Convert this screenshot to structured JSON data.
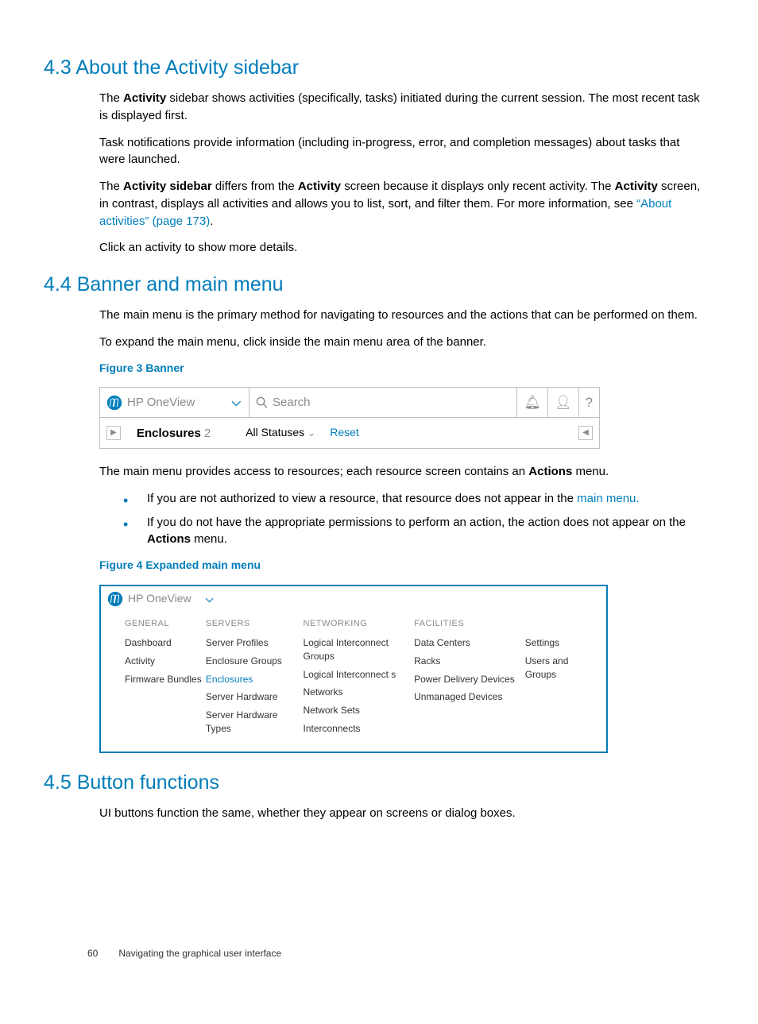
{
  "sections": {
    "s43": {
      "heading": "4.3 About the Activity sidebar",
      "p1_a": "The ",
      "p1_b": "Activity",
      "p1_c": " sidebar shows activities (specifically, tasks) initiated during the current session. The most recent task is displayed first.",
      "p2": "Task notifications provide information (including in-progress, error, and completion messages) about tasks that were launched.",
      "p3_a": "The ",
      "p3_b": "Activity sidebar",
      "p3_c": " differs from the ",
      "p3_d": "Activity",
      "p3_e": " screen because it displays only recent activity. The ",
      "p3_f": "Activity",
      "p3_g": " screen, in contrast, displays all activities and allows you to list, sort, and filter them. For more information, see ",
      "p3_link": "“About activities” (page 173)",
      "p3_h": ".",
      "p4": "Click an activity to show more details."
    },
    "s44": {
      "heading": "4.4 Banner and main menu",
      "p1": "The main menu is the primary method for navigating to resources and the actions that can be performed on them.",
      "p2": "To expand the main menu, click inside the main menu area of the banner.",
      "fig3cap": "Figure 3 Banner",
      "p3_a": "The main menu provides access to resources; each resource screen contains an ",
      "p3_b": "Actions",
      "p3_c": " menu.",
      "b1_a": "If you are not authorized to view a resource, that resource does not appear in the ",
      "b1_link": "main menu.",
      "b2_a": "If you do not have the appropriate permissions to perform an action, the action does not appear on the ",
      "b2_b": "Actions",
      "b2_c": " menu.",
      "fig4cap": "Figure 4 Expanded main menu"
    },
    "s45": {
      "heading": "4.5 Button functions",
      "p1": "UI buttons function the same, whether they appear on screens or dialog boxes."
    }
  },
  "fig3": {
    "product": "HP OneView",
    "search_placeholder": "Search",
    "resource": "Enclosures",
    "count": "2",
    "filter": "All Statuses",
    "reset": "Reset"
  },
  "fig4": {
    "product": "HP OneView",
    "cols": {
      "general": {
        "hdr": "GENERAL",
        "i0": "Dashboard",
        "i1": "Activity",
        "i2": "Firmware Bundles"
      },
      "servers": {
        "hdr": "SERVERS",
        "i0": "Server Profiles",
        "i1": "Enclosure Groups",
        "i2": "Enclosures",
        "i3": "Server Hardware",
        "i4": "Server Hardware Types"
      },
      "networking": {
        "hdr": "NETWORKING",
        "i0": "Logical Interconnect Groups",
        "i1": "Logical Interconnect s",
        "i2": "Networks",
        "i3": "Network Sets",
        "i4": "Interconnects"
      },
      "facilities": {
        "hdr": "FACILITIES",
        "i0": "Data Centers",
        "i1": "Racks",
        "i2": "Power Delivery Devices",
        "i3": "Unmanaged Devices"
      },
      "other": {
        "i0": "Settings",
        "i1": "Users and Groups"
      }
    }
  },
  "footer": {
    "page": "60",
    "chapter": "Navigating the graphical user interface"
  }
}
